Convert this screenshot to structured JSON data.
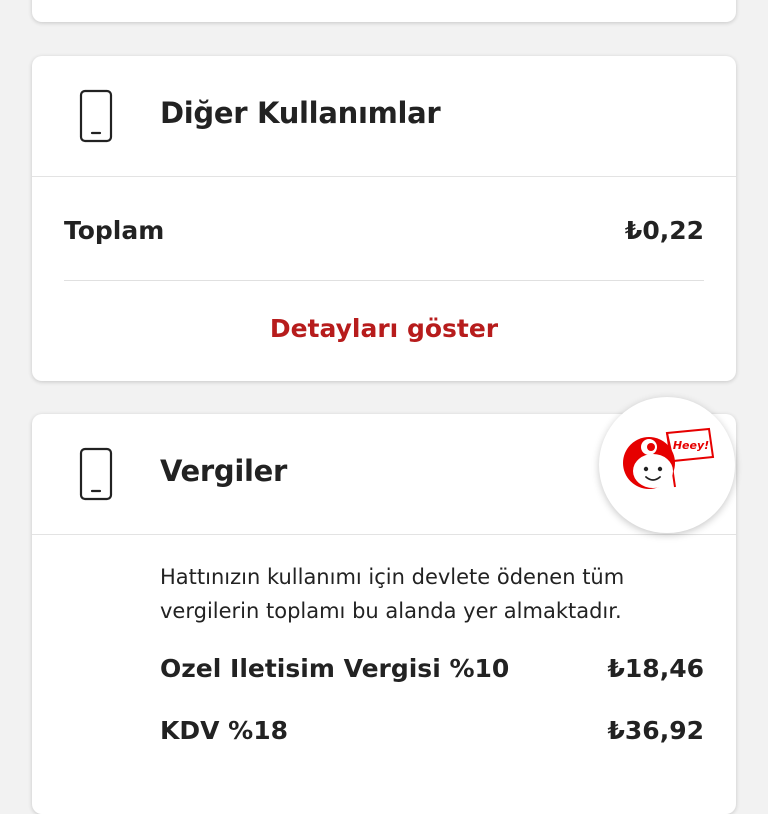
{
  "other_usage": {
    "title": "Diğer Kullanımlar",
    "icon": "phone-icon",
    "total_label": "Toplam",
    "total_value": "₺0,22",
    "details_link": "Detayları göster"
  },
  "taxes": {
    "title": "Vergiler",
    "icon": "phone-icon",
    "description": "Hattınızın kullanımı için devlete ödenen tüm vergilerin toplamı bu alanda yer almaktadır.",
    "items": [
      {
        "label": "Ozel Iletisim Vergisi %10",
        "value": "₺18,46"
      },
      {
        "label": "KDV %18",
        "value": "₺36,92"
      }
    ]
  },
  "assistant": {
    "bubble_text": "Heey!",
    "icon": "vodafone-assistant-icon"
  },
  "colors": {
    "accent": "#b71c1c",
    "brand_red": "#e60000",
    "background": "#f2f2f2",
    "card": "#ffffff"
  }
}
